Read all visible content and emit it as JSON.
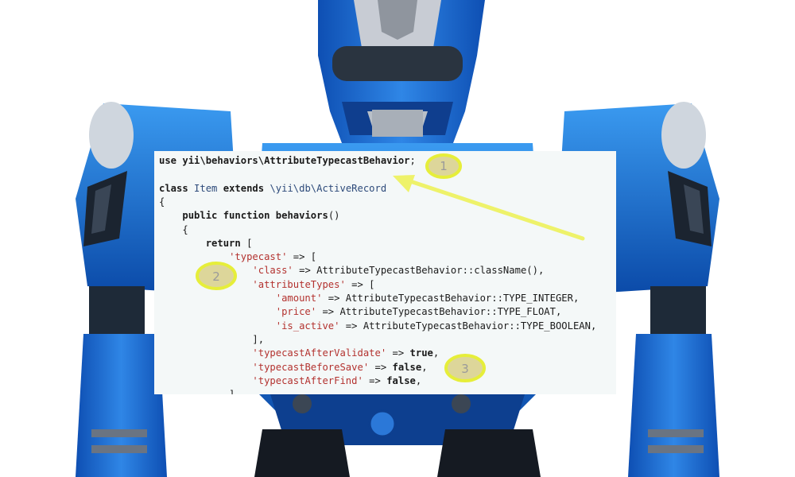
{
  "code_lines": [
    {
      "parts": [
        {
          "t": "use ",
          "c": "kw"
        },
        {
          "t": "yii\\behaviors\\AttributeTypecastBehavior",
          "c": "kw"
        },
        {
          "t": ";",
          "c": ""
        }
      ]
    },
    {
      "parts": []
    },
    {
      "parts": [
        {
          "t": "class ",
          "c": "kw"
        },
        {
          "t": "Item",
          "c": "cls"
        },
        {
          "t": " extends ",
          "c": "kw"
        },
        {
          "t": "\\yii\\db\\ActiveRecord",
          "c": "cls"
        }
      ]
    },
    {
      "parts": [
        {
          "t": "{",
          "c": ""
        }
      ]
    },
    {
      "parts": [
        {
          "t": "    ",
          "c": ""
        },
        {
          "t": "public function ",
          "c": "kw"
        },
        {
          "t": "behaviors",
          "c": "kw"
        },
        {
          "t": "()",
          "c": ""
        }
      ]
    },
    {
      "parts": [
        {
          "t": "    {",
          "c": ""
        }
      ]
    },
    {
      "parts": [
        {
          "t": "        ",
          "c": ""
        },
        {
          "t": "return",
          "c": "kw"
        },
        {
          "t": " [",
          "c": ""
        }
      ]
    },
    {
      "parts": [
        {
          "t": "            ",
          "c": ""
        },
        {
          "t": "'typecast'",
          "c": "str"
        },
        {
          "t": " => [",
          "c": ""
        }
      ]
    },
    {
      "parts": [
        {
          "t": "                ",
          "c": ""
        },
        {
          "t": "'class'",
          "c": "str"
        },
        {
          "t": " => AttributeTypecastBehavior::className(),",
          "c": ""
        }
      ]
    },
    {
      "parts": [
        {
          "t": "                ",
          "c": ""
        },
        {
          "t": "'attributeTypes'",
          "c": "str"
        },
        {
          "t": " => [",
          "c": ""
        }
      ]
    },
    {
      "parts": [
        {
          "t": "                    ",
          "c": ""
        },
        {
          "t": "'amount'",
          "c": "str"
        },
        {
          "t": " => AttributeTypecastBehavior::TYPE_INTEGER,",
          "c": ""
        }
      ]
    },
    {
      "parts": [
        {
          "t": "                    ",
          "c": ""
        },
        {
          "t": "'price'",
          "c": "str"
        },
        {
          "t": " => AttributeTypecastBehavior::TYPE_FLOAT,",
          "c": ""
        }
      ]
    },
    {
      "parts": [
        {
          "t": "                    ",
          "c": ""
        },
        {
          "t": "'is_active'",
          "c": "str"
        },
        {
          "t": " => AttributeTypecastBehavior::TYPE_BOOLEAN,",
          "c": ""
        }
      ]
    },
    {
      "parts": [
        {
          "t": "                ],",
          "c": ""
        }
      ]
    },
    {
      "parts": [
        {
          "t": "                ",
          "c": ""
        },
        {
          "t": "'typecastAfterValidate'",
          "c": "str"
        },
        {
          "t": " => ",
          "c": ""
        },
        {
          "t": "true",
          "c": "kw"
        },
        {
          "t": ",",
          "c": ""
        }
      ]
    },
    {
      "parts": [
        {
          "t": "                ",
          "c": ""
        },
        {
          "t": "'typecastBeforeSave'",
          "c": "str"
        },
        {
          "t": " => ",
          "c": ""
        },
        {
          "t": "false",
          "c": "kw"
        },
        {
          "t": ",",
          "c": ""
        }
      ]
    },
    {
      "parts": [
        {
          "t": "                ",
          "c": ""
        },
        {
          "t": "'typecastAfterFind'",
          "c": "str"
        },
        {
          "t": " => ",
          "c": ""
        },
        {
          "t": "false",
          "c": "kw"
        },
        {
          "t": ",",
          "c": ""
        }
      ]
    },
    {
      "parts": [
        {
          "t": "            ],",
          "c": ""
        }
      ]
    }
  ],
  "markers": [
    "1",
    "2",
    "3"
  ],
  "colors": {
    "robot_blue": "#1f6fd1",
    "robot_dark_blue": "#0d3f8f",
    "marker_fill": "#d8d08a",
    "marker_stroke": "#e6ee3a",
    "arrow": "#eef26a"
  }
}
